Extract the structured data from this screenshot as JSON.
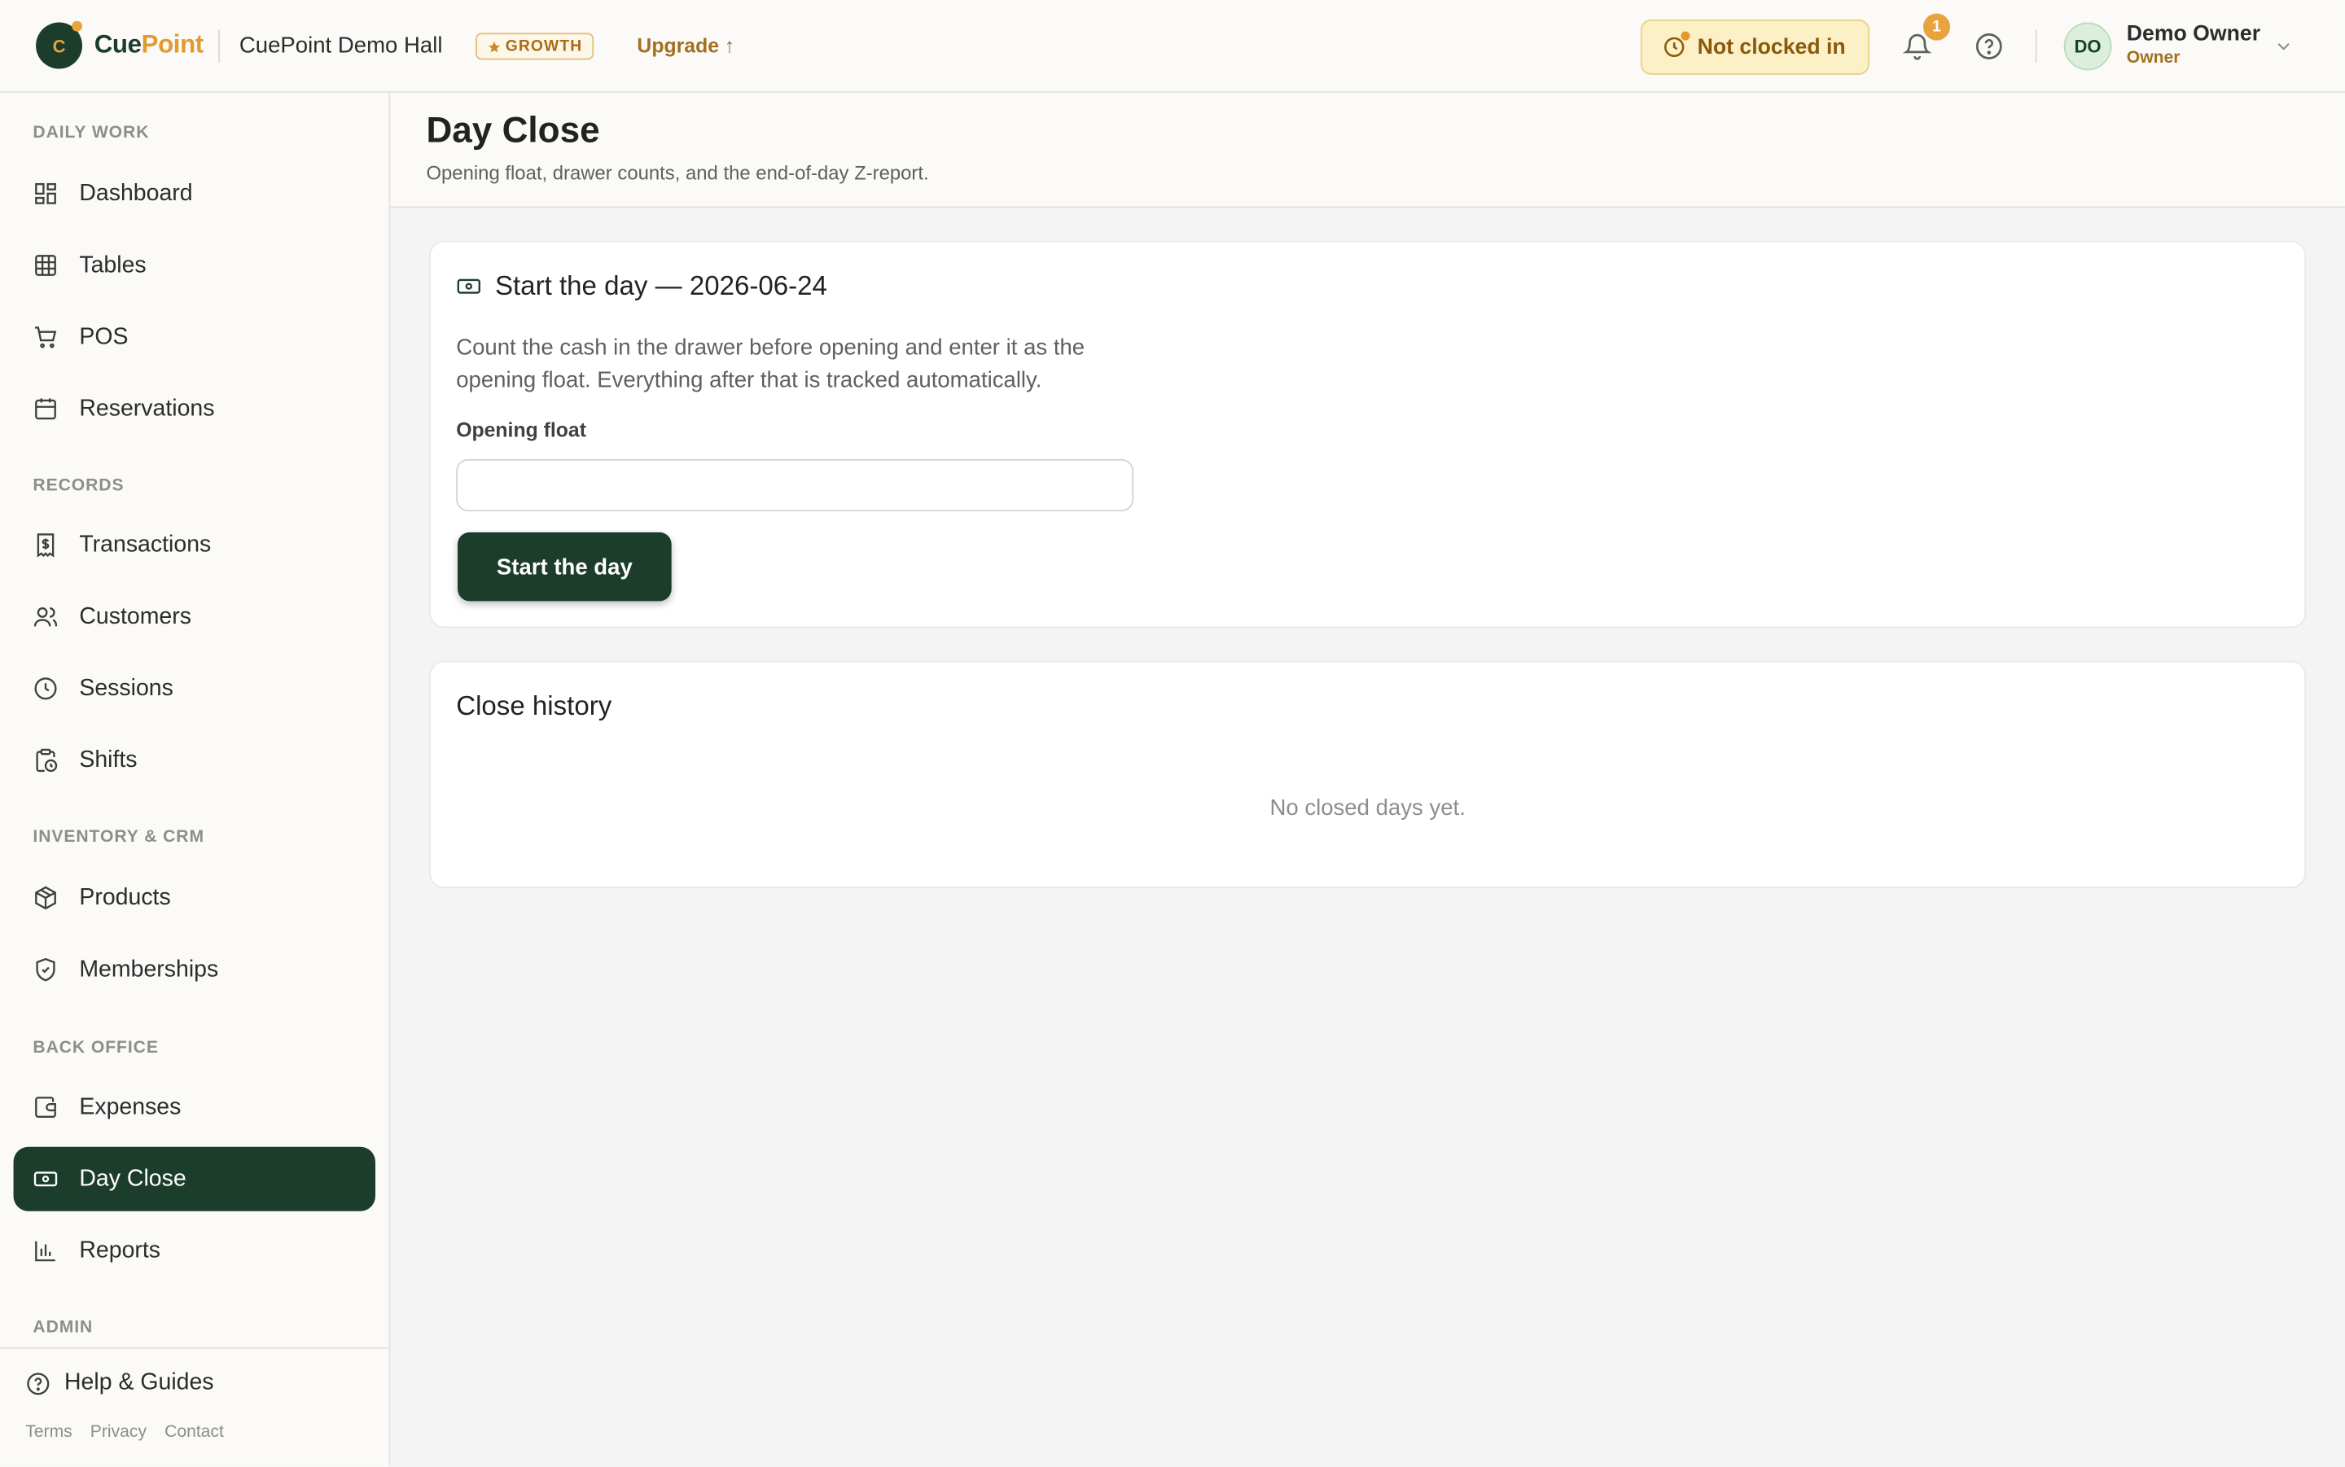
{
  "topbar": {
    "logo_letter": "C",
    "logo_cue": "Cue",
    "logo_point": "Point",
    "venue": "CuePoint Demo Hall",
    "plan_badge": "GROWTH",
    "upgrade": "Upgrade ↑",
    "clock_status": "Not clocked in",
    "notifications_count": "1",
    "user": {
      "initials": "DO",
      "name": "Demo Owner",
      "role": "Owner"
    }
  },
  "sidebar": {
    "sections": {
      "daily_work": "DAILY WORK",
      "records": "RECORDS",
      "inventory_crm": "INVENTORY & CRM",
      "back_office": "BACK OFFICE",
      "admin": "ADMIN"
    },
    "items": [
      {
        "label": "Dashboard",
        "icon": "dashboard-icon"
      },
      {
        "label": "Tables",
        "icon": "grid-icon"
      },
      {
        "label": "POS",
        "icon": "cart-icon"
      },
      {
        "label": "Reservations",
        "icon": "calendar-icon"
      },
      {
        "label": "Transactions",
        "icon": "receipt-icon"
      },
      {
        "label": "Customers",
        "icon": "users-icon"
      },
      {
        "label": "Sessions",
        "icon": "clock-icon"
      },
      {
        "label": "Shifts",
        "icon": "clipboard-clock-icon"
      },
      {
        "label": "Products",
        "icon": "package-icon"
      },
      {
        "label": "Memberships",
        "icon": "shield-icon"
      },
      {
        "label": "Expenses",
        "icon": "wallet-icon"
      },
      {
        "label": "Day Close",
        "icon": "banknote-icon",
        "active": true
      },
      {
        "label": "Reports",
        "icon": "bar-chart-icon"
      }
    ],
    "help": "Help & Guides",
    "footer_links": [
      "Terms",
      "Privacy",
      "Contact"
    ]
  },
  "page": {
    "title": "Day Close",
    "subtitle": "Opening float, drawer counts, and the end-of-day Z-report."
  },
  "start_card": {
    "title": "Start the day — 2026-06-24",
    "description": "Count the cash in the drawer before opening and enter it as the opening float. Everything after that is tracked automatically.",
    "float_label": "Opening float",
    "float_value": "",
    "button": "Start the day"
  },
  "history_card": {
    "title": "Close history",
    "empty": "No closed days yet."
  },
  "colors": {
    "brand_green": "#1c3d2c",
    "accent_amber": "#e39a2f",
    "clock_pill_bg": "#fbf0c6"
  }
}
